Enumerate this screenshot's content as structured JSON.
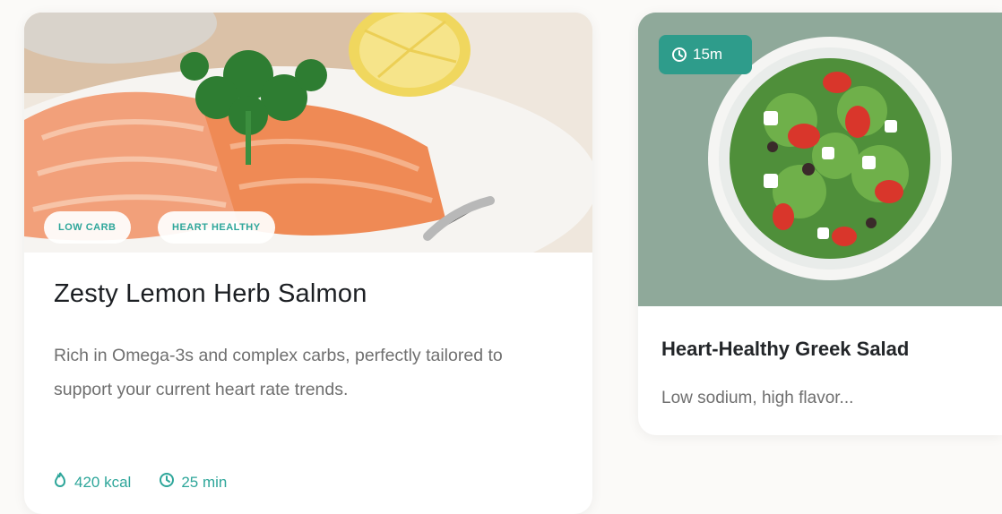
{
  "cards": [
    {
      "title": "Zesty Lemon Herb Salmon",
      "description": "Rich in Omega-3s and complex carbs, perfectly tailored to support your current heart rate trends.",
      "tags": [
        "LOW CARB",
        "HEART HEALTHY"
      ],
      "calories": "420 kcal",
      "time": "25 min",
      "image": "salmon-with-lemon-and-parsley"
    },
    {
      "title": "Heart-Healthy Greek Salad",
      "description": "Low sodium, high flavor...",
      "time_badge": "15m",
      "image": "greek-salad-bowl"
    }
  ],
  "colors": {
    "accent": "#2ea69a",
    "badge_bg": "#2e9c8b",
    "text": "#1f2328",
    "muted": "#6f6f6f"
  }
}
